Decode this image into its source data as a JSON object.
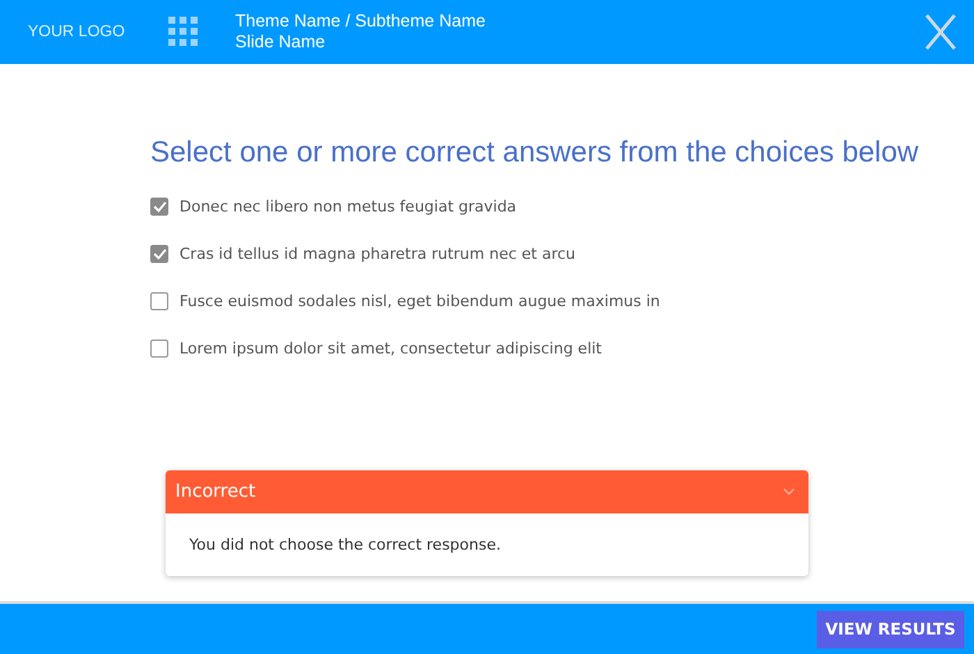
{
  "header": {
    "logo": "YOUR LOGO",
    "breadcrumb": "Theme Name / Subtheme Name",
    "slide": "Slide Name"
  },
  "question": "Select one or more correct answers from the choices below",
  "choices": [
    {
      "label": "Donec nec libero non metus feugiat gravida",
      "checked": true
    },
    {
      "label": "Cras id tellus id magna pharetra rutrum nec et arcu",
      "checked": true
    },
    {
      "label": "Fusce euismod sodales nisl, eget bibendum augue maximus in",
      "checked": false
    },
    {
      "label": "Lorem ipsum dolor sit amet, consectetur adipiscing elit",
      "checked": false
    }
  ],
  "feedback": {
    "title": "Incorrect",
    "message": "You did not choose the correct response.",
    "expanded": true
  },
  "footer": {
    "button": "VIEW RESULTS"
  }
}
